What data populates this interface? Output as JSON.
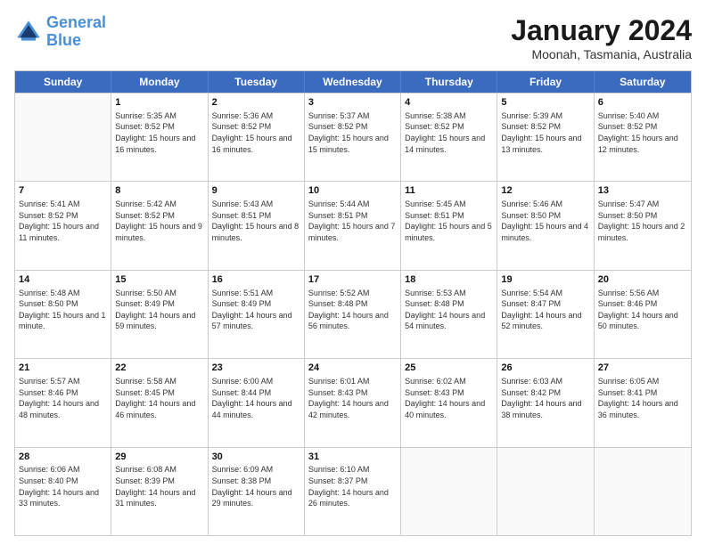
{
  "header": {
    "logo_general": "General",
    "logo_blue": "Blue",
    "month_title": "January 2024",
    "location": "Moonah, Tasmania, Australia"
  },
  "days_of_week": [
    "Sunday",
    "Monday",
    "Tuesday",
    "Wednesday",
    "Thursday",
    "Friday",
    "Saturday"
  ],
  "weeks": [
    [
      {
        "day": "",
        "sunrise": "",
        "sunset": "",
        "daylight": ""
      },
      {
        "day": "1",
        "sunrise": "Sunrise: 5:35 AM",
        "sunset": "Sunset: 8:52 PM",
        "daylight": "Daylight: 15 hours and 16 minutes."
      },
      {
        "day": "2",
        "sunrise": "Sunrise: 5:36 AM",
        "sunset": "Sunset: 8:52 PM",
        "daylight": "Daylight: 15 hours and 16 minutes."
      },
      {
        "day": "3",
        "sunrise": "Sunrise: 5:37 AM",
        "sunset": "Sunset: 8:52 PM",
        "daylight": "Daylight: 15 hours and 15 minutes."
      },
      {
        "day": "4",
        "sunrise": "Sunrise: 5:38 AM",
        "sunset": "Sunset: 8:52 PM",
        "daylight": "Daylight: 15 hours and 14 minutes."
      },
      {
        "day": "5",
        "sunrise": "Sunrise: 5:39 AM",
        "sunset": "Sunset: 8:52 PM",
        "daylight": "Daylight: 15 hours and 13 minutes."
      },
      {
        "day": "6",
        "sunrise": "Sunrise: 5:40 AM",
        "sunset": "Sunset: 8:52 PM",
        "daylight": "Daylight: 15 hours and 12 minutes."
      }
    ],
    [
      {
        "day": "7",
        "sunrise": "Sunrise: 5:41 AM",
        "sunset": "Sunset: 8:52 PM",
        "daylight": "Daylight: 15 hours and 11 minutes."
      },
      {
        "day": "8",
        "sunrise": "Sunrise: 5:42 AM",
        "sunset": "Sunset: 8:52 PM",
        "daylight": "Daylight: 15 hours and 9 minutes."
      },
      {
        "day": "9",
        "sunrise": "Sunrise: 5:43 AM",
        "sunset": "Sunset: 8:51 PM",
        "daylight": "Daylight: 15 hours and 8 minutes."
      },
      {
        "day": "10",
        "sunrise": "Sunrise: 5:44 AM",
        "sunset": "Sunset: 8:51 PM",
        "daylight": "Daylight: 15 hours and 7 minutes."
      },
      {
        "day": "11",
        "sunrise": "Sunrise: 5:45 AM",
        "sunset": "Sunset: 8:51 PM",
        "daylight": "Daylight: 15 hours and 5 minutes."
      },
      {
        "day": "12",
        "sunrise": "Sunrise: 5:46 AM",
        "sunset": "Sunset: 8:50 PM",
        "daylight": "Daylight: 15 hours and 4 minutes."
      },
      {
        "day": "13",
        "sunrise": "Sunrise: 5:47 AM",
        "sunset": "Sunset: 8:50 PM",
        "daylight": "Daylight: 15 hours and 2 minutes."
      }
    ],
    [
      {
        "day": "14",
        "sunrise": "Sunrise: 5:48 AM",
        "sunset": "Sunset: 8:50 PM",
        "daylight": "Daylight: 15 hours and 1 minute."
      },
      {
        "day": "15",
        "sunrise": "Sunrise: 5:50 AM",
        "sunset": "Sunset: 8:49 PM",
        "daylight": "Daylight: 14 hours and 59 minutes."
      },
      {
        "day": "16",
        "sunrise": "Sunrise: 5:51 AM",
        "sunset": "Sunset: 8:49 PM",
        "daylight": "Daylight: 14 hours and 57 minutes."
      },
      {
        "day": "17",
        "sunrise": "Sunrise: 5:52 AM",
        "sunset": "Sunset: 8:48 PM",
        "daylight": "Daylight: 14 hours and 56 minutes."
      },
      {
        "day": "18",
        "sunrise": "Sunrise: 5:53 AM",
        "sunset": "Sunset: 8:48 PM",
        "daylight": "Daylight: 14 hours and 54 minutes."
      },
      {
        "day": "19",
        "sunrise": "Sunrise: 5:54 AM",
        "sunset": "Sunset: 8:47 PM",
        "daylight": "Daylight: 14 hours and 52 minutes."
      },
      {
        "day": "20",
        "sunrise": "Sunrise: 5:56 AM",
        "sunset": "Sunset: 8:46 PM",
        "daylight": "Daylight: 14 hours and 50 minutes."
      }
    ],
    [
      {
        "day": "21",
        "sunrise": "Sunrise: 5:57 AM",
        "sunset": "Sunset: 8:46 PM",
        "daylight": "Daylight: 14 hours and 48 minutes."
      },
      {
        "day": "22",
        "sunrise": "Sunrise: 5:58 AM",
        "sunset": "Sunset: 8:45 PM",
        "daylight": "Daylight: 14 hours and 46 minutes."
      },
      {
        "day": "23",
        "sunrise": "Sunrise: 6:00 AM",
        "sunset": "Sunset: 8:44 PM",
        "daylight": "Daylight: 14 hours and 44 minutes."
      },
      {
        "day": "24",
        "sunrise": "Sunrise: 6:01 AM",
        "sunset": "Sunset: 8:43 PM",
        "daylight": "Daylight: 14 hours and 42 minutes."
      },
      {
        "day": "25",
        "sunrise": "Sunrise: 6:02 AM",
        "sunset": "Sunset: 8:43 PM",
        "daylight": "Daylight: 14 hours and 40 minutes."
      },
      {
        "day": "26",
        "sunrise": "Sunrise: 6:03 AM",
        "sunset": "Sunset: 8:42 PM",
        "daylight": "Daylight: 14 hours and 38 minutes."
      },
      {
        "day": "27",
        "sunrise": "Sunrise: 6:05 AM",
        "sunset": "Sunset: 8:41 PM",
        "daylight": "Daylight: 14 hours and 36 minutes."
      }
    ],
    [
      {
        "day": "28",
        "sunrise": "Sunrise: 6:06 AM",
        "sunset": "Sunset: 8:40 PM",
        "daylight": "Daylight: 14 hours and 33 minutes."
      },
      {
        "day": "29",
        "sunrise": "Sunrise: 6:08 AM",
        "sunset": "Sunset: 8:39 PM",
        "daylight": "Daylight: 14 hours and 31 minutes."
      },
      {
        "day": "30",
        "sunrise": "Sunrise: 6:09 AM",
        "sunset": "Sunset: 8:38 PM",
        "daylight": "Daylight: 14 hours and 29 minutes."
      },
      {
        "day": "31",
        "sunrise": "Sunrise: 6:10 AM",
        "sunset": "Sunset: 8:37 PM",
        "daylight": "Daylight: 14 hours and 26 minutes."
      },
      {
        "day": "",
        "sunrise": "",
        "sunset": "",
        "daylight": ""
      },
      {
        "day": "",
        "sunrise": "",
        "sunset": "",
        "daylight": ""
      },
      {
        "day": "",
        "sunrise": "",
        "sunset": "",
        "daylight": ""
      }
    ]
  ]
}
